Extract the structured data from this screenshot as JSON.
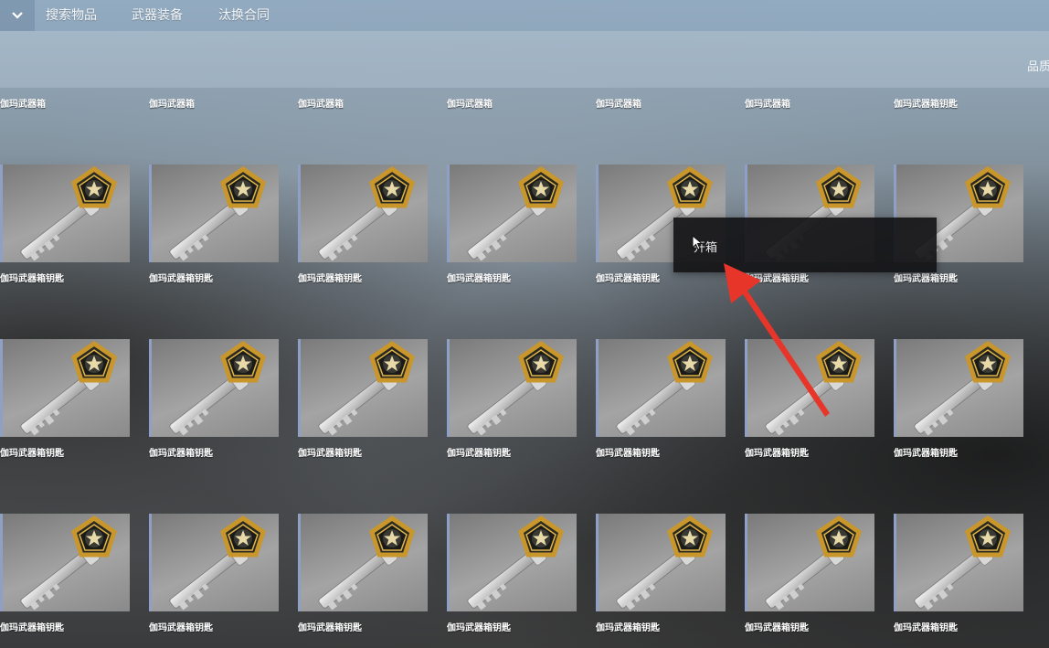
{
  "nav": {
    "tabs": [
      "搜索物品",
      "武器装备",
      "汰换合同"
    ],
    "dropdown_icon": "chevron-down-icon"
  },
  "toolbar": {
    "quality_label": "品质"
  },
  "items": {
    "top_labels": [
      "伽玛武器箱",
      "伽玛武器箱",
      "伽玛武器箱",
      "伽玛武器箱",
      "伽玛武器箱",
      "伽玛武器箱",
      "伽玛武器箱钥匙"
    ],
    "key_name": "伽玛武器箱钥匙"
  },
  "context_menu": {
    "open_case": "开箱"
  },
  "colors": {
    "annotation_arrow": "#e8352a",
    "tile_border": "#8ea0c6",
    "key_gold": "#c8962a"
  }
}
